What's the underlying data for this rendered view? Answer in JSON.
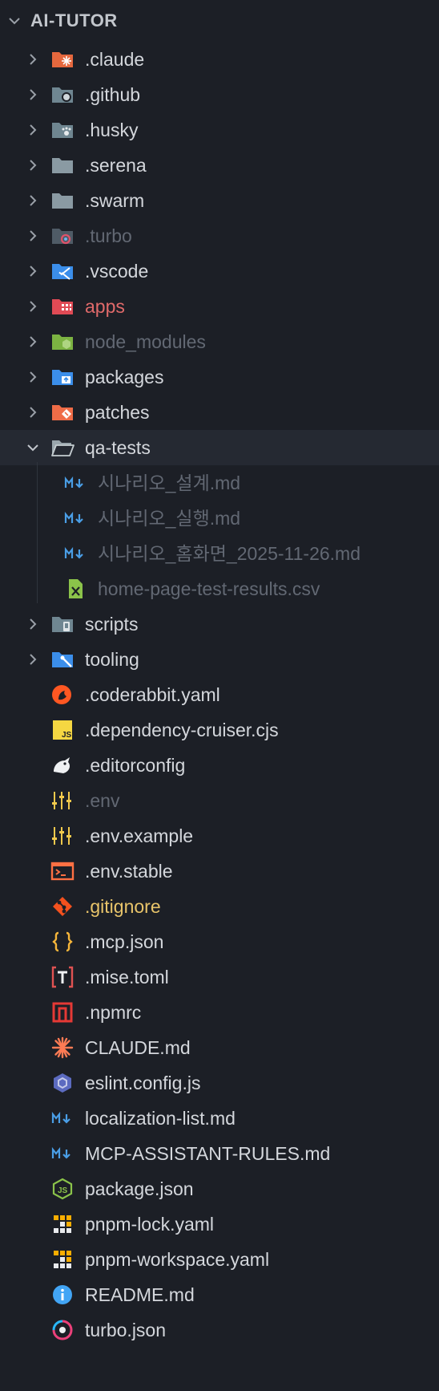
{
  "explorer": {
    "title": "AI-TUTOR",
    "colors": {
      "background": "#1c1f26",
      "active_row": "#252932",
      "text": "#d4d7dc",
      "dim_text": "#626873",
      "red_text": "#e06a6a",
      "yellow_text": "#e8c46a"
    },
    "items": [
      {
        "label": ".claude",
        "kind": "folder",
        "expanded": false,
        "icon": "claude-folder-icon"
      },
      {
        "label": ".github",
        "kind": "folder",
        "expanded": false,
        "icon": "github-folder-icon"
      },
      {
        "label": ".husky",
        "kind": "folder",
        "expanded": false,
        "icon": "husky-folder-icon"
      },
      {
        "label": ".serena",
        "kind": "folder",
        "expanded": false,
        "icon": "folder-icon"
      },
      {
        "label": ".swarm",
        "kind": "folder",
        "expanded": false,
        "icon": "folder-icon"
      },
      {
        "label": ".turbo",
        "kind": "folder",
        "expanded": false,
        "icon": "turbo-folder-icon",
        "dimmed": true
      },
      {
        "label": ".vscode",
        "kind": "folder",
        "expanded": false,
        "icon": "vscode-folder-icon"
      },
      {
        "label": "apps",
        "kind": "folder",
        "expanded": false,
        "icon": "apps-folder-icon",
        "status": "error"
      },
      {
        "label": "node_modules",
        "kind": "folder",
        "expanded": false,
        "icon": "node-folder-icon",
        "dimmed": true
      },
      {
        "label": "packages",
        "kind": "folder",
        "expanded": false,
        "icon": "packages-folder-icon"
      },
      {
        "label": "patches",
        "kind": "folder",
        "expanded": false,
        "icon": "patches-folder-icon"
      },
      {
        "label": "qa-tests",
        "kind": "folder",
        "expanded": true,
        "icon": "open-folder-icon"
      },
      {
        "label": "시나리오_설계.md",
        "kind": "file",
        "icon": "markdown-icon",
        "dimmed": true
      },
      {
        "label": "시나리오_실행.md",
        "kind": "file",
        "icon": "markdown-icon",
        "dimmed": true
      },
      {
        "label": "시나리오_홈화면_2025-11-26.md",
        "kind": "file",
        "icon": "markdown-icon",
        "dimmed": true
      },
      {
        "label": "home-page-test-results.csv",
        "kind": "file",
        "icon": "csv-icon",
        "dimmed": true
      },
      {
        "label": "scripts",
        "kind": "folder",
        "expanded": false,
        "icon": "scripts-folder-icon"
      },
      {
        "label": "tooling",
        "kind": "folder",
        "expanded": false,
        "icon": "tooling-folder-icon"
      },
      {
        "label": ".coderabbit.yaml",
        "kind": "file",
        "icon": "coderabbit-icon"
      },
      {
        "label": ".dependency-cruiser.cjs",
        "kind": "file",
        "icon": "js-icon"
      },
      {
        "label": ".editorconfig",
        "kind": "file",
        "icon": "editorconfig-icon"
      },
      {
        "label": ".env",
        "kind": "file",
        "icon": "env-icon",
        "dimmed": true
      },
      {
        "label": ".env.example",
        "kind": "file",
        "icon": "env-icon"
      },
      {
        "label": ".env.stable",
        "kind": "file",
        "icon": "terminal-icon"
      },
      {
        "label": ".gitignore",
        "kind": "file",
        "icon": "git-icon",
        "status": "modified"
      },
      {
        "label": ".mcp.json",
        "kind": "file",
        "icon": "json-braces-icon"
      },
      {
        "label": ".mise.toml",
        "kind": "file",
        "icon": "toml-icon"
      },
      {
        "label": ".npmrc",
        "kind": "file",
        "icon": "npm-icon"
      },
      {
        "label": "CLAUDE.md",
        "kind": "file",
        "icon": "claude-icon"
      },
      {
        "label": "eslint.config.js",
        "kind": "file",
        "icon": "eslint-icon"
      },
      {
        "label": "localization-list.md",
        "kind": "file",
        "icon": "markdown-icon"
      },
      {
        "label": "MCP-ASSISTANT-RULES.md",
        "kind": "file",
        "icon": "markdown-icon"
      },
      {
        "label": "package.json",
        "kind": "file",
        "icon": "nodejs-icon"
      },
      {
        "label": "pnpm-lock.yaml",
        "kind": "file",
        "icon": "pnpm-icon"
      },
      {
        "label": "pnpm-workspace.yaml",
        "kind": "file",
        "icon": "pnpm-icon"
      },
      {
        "label": "README.md",
        "kind": "file",
        "icon": "info-icon"
      },
      {
        "label": "turbo.json",
        "kind": "file",
        "icon": "turbo-icon"
      }
    ]
  }
}
